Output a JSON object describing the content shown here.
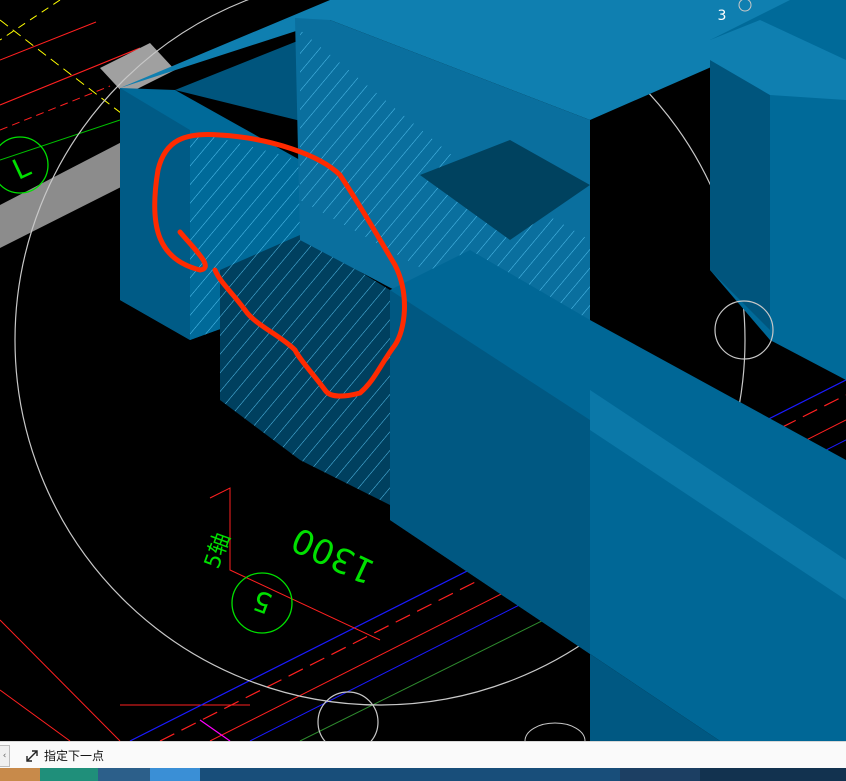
{
  "viewport": {
    "axis_numbers": {
      "top_right": "3"
    },
    "dimension_text": "1300",
    "axis_label_text": "5轴",
    "axis_bubble_left": "L",
    "axis_bubble_bottom": "5"
  },
  "statusbar": {
    "prompt": "指定下一点"
  },
  "colors": {
    "wall": "#006a99",
    "wall_dark": "#00547a",
    "wall_light": "#0f81b4",
    "hatch": "#55c7ff",
    "annotation_red": "#ff2a00",
    "cad_green": "#00e000",
    "cad_yellow": "#ffff00",
    "cad_red": "#ff0000",
    "cad_blue": "#0000ff",
    "cad_magenta": "#ff00ff"
  }
}
